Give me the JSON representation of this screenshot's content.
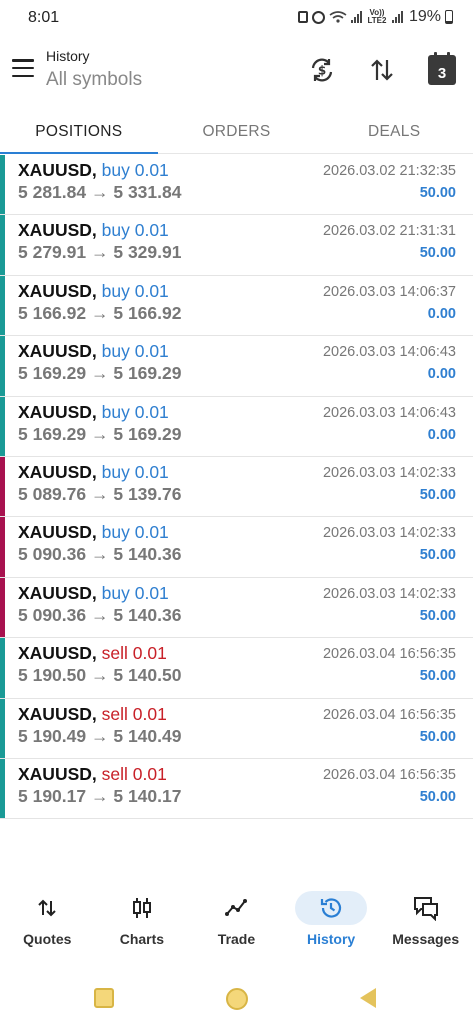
{
  "status_bar": {
    "time": "8:01",
    "battery_percent": "19%",
    "network_label": "Vo)) LTE2",
    "icons": [
      "lock-icon",
      "alarm-icon",
      "wifi-icon",
      "signal-icon",
      "volte-icon",
      "signal-icon",
      "battery-icon"
    ]
  },
  "header": {
    "title": "History",
    "subtitle": "All symbols",
    "actions": [
      {
        "name": "currency-sync-icon"
      },
      {
        "name": "sort-icon"
      },
      {
        "name": "calendar-icon",
        "label": "3"
      }
    ]
  },
  "tabs": [
    {
      "label": "POSITIONS",
      "active": true
    },
    {
      "label": "ORDERS",
      "active": false
    },
    {
      "label": "DEALS",
      "active": false
    }
  ],
  "colors": {
    "accent": "#2a7fd4",
    "buy": "#2f7fd0",
    "sell": "#c82028",
    "profit": "#2f7fd0",
    "marker_teal": "#1a9a96",
    "marker_magenta": "#a8124f"
  },
  "positions": [
    {
      "symbol": "XAUUSD,",
      "side": "buy 0.01",
      "type": "buy",
      "prices": "5 281.84 → 5 331.84",
      "time": "2026.03.02 21:32:35",
      "profit": "50.00",
      "marker": "teal"
    },
    {
      "symbol": "XAUUSD,",
      "side": "buy 0.01",
      "type": "buy",
      "prices": "5 279.91 → 5 329.91",
      "time": "2026.03.02 21:31:31",
      "profit": "50.00",
      "marker": "teal"
    },
    {
      "symbol": "XAUUSD,",
      "side": "buy 0.01",
      "type": "buy",
      "prices": "5 166.92 → 5 166.92",
      "time": "2026.03.03 14:06:37",
      "profit": "0.00",
      "marker": "teal"
    },
    {
      "symbol": "XAUUSD,",
      "side": "buy 0.01",
      "type": "buy",
      "prices": "5 169.29 → 5 169.29",
      "time": "2026.03.03 14:06:43",
      "profit": "0.00",
      "marker": "teal"
    },
    {
      "symbol": "XAUUSD,",
      "side": "buy 0.01",
      "type": "buy",
      "prices": "5 169.29 → 5 169.29",
      "time": "2026.03.03 14:06:43",
      "profit": "0.00",
      "marker": "teal"
    },
    {
      "symbol": "XAUUSD,",
      "side": "buy 0.01",
      "type": "buy",
      "prices": "5 089.76 → 5 139.76",
      "time": "2026.03.03 14:02:33",
      "profit": "50.00",
      "marker": "magenta"
    },
    {
      "symbol": "XAUUSD,",
      "side": "buy 0.01",
      "type": "buy",
      "prices": "5 090.36 → 5 140.36",
      "time": "2026.03.03 14:02:33",
      "profit": "50.00",
      "marker": "magenta"
    },
    {
      "symbol": "XAUUSD,",
      "side": "buy 0.01",
      "type": "buy",
      "prices": "5 090.36 → 5 140.36",
      "time": "2026.03.03 14:02:33",
      "profit": "50.00",
      "marker": "magenta"
    },
    {
      "symbol": "XAUUSD,",
      "side": "sell 0.01",
      "type": "sell",
      "prices": "5 190.50 → 5 140.50",
      "time": "2026.03.04 16:56:35",
      "profit": "50.00",
      "marker": "teal"
    },
    {
      "symbol": "XAUUSD,",
      "side": "sell 0.01",
      "type": "sell",
      "prices": "5 190.49 → 5 140.49",
      "time": "2026.03.04 16:56:35",
      "profit": "50.00",
      "marker": "teal"
    },
    {
      "symbol": "XAUUSD,",
      "side": "sell 0.01",
      "type": "sell",
      "prices": "5 190.17 → 5 140.17",
      "time": "2026.03.04 16:56:35",
      "profit": "50.00",
      "marker": "teal"
    }
  ],
  "bottom_nav": [
    {
      "label": "Quotes",
      "icon": "quotes-icon",
      "active": false
    },
    {
      "label": "Charts",
      "icon": "charts-icon",
      "active": false
    },
    {
      "label": "Trade",
      "icon": "trade-icon",
      "active": false
    },
    {
      "label": "History",
      "icon": "history-icon",
      "active": true
    },
    {
      "label": "Messages",
      "icon": "messages-icon",
      "active": false
    }
  ],
  "system_nav": [
    "recent-apps-icon",
    "home-icon",
    "back-icon"
  ]
}
